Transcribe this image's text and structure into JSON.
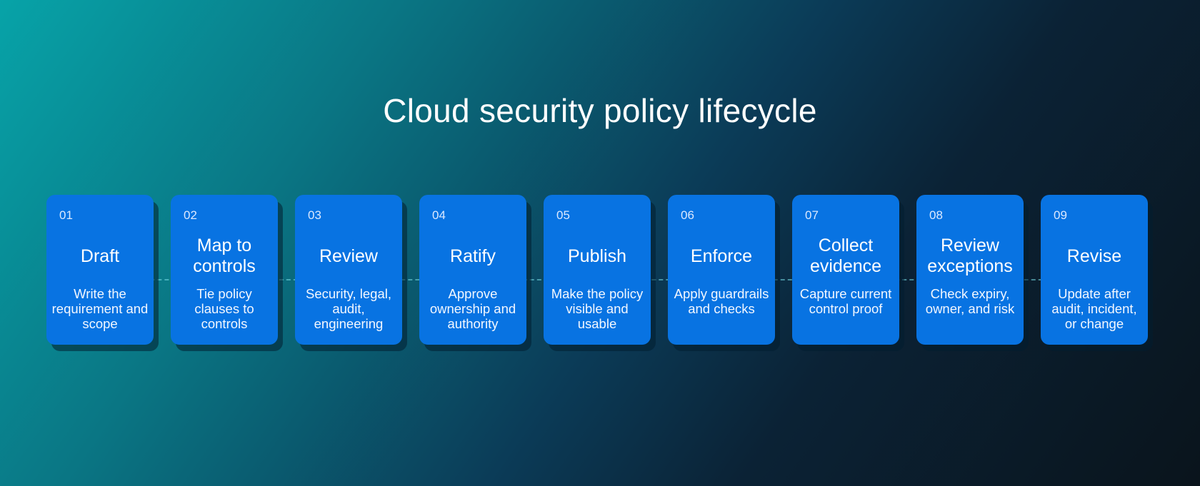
{
  "title": "Cloud security policy lifecycle",
  "colors": {
    "card": "#0873e2",
    "background_start": "#07a3a8",
    "background_end": "#0a141c"
  },
  "steps": [
    {
      "number": "01",
      "title": "Draft",
      "description": "Write the requirement and scope"
    },
    {
      "number": "02",
      "title": "Map to controls",
      "description": "Tie policy clauses to controls"
    },
    {
      "number": "03",
      "title": "Review",
      "description": "Security, legal, audit, engineering"
    },
    {
      "number": "04",
      "title": "Ratify",
      "description": "Approve ownership and authority"
    },
    {
      "number": "05",
      "title": "Publish",
      "description": "Make the policy visible and usable"
    },
    {
      "number": "06",
      "title": "Enforce",
      "description": "Apply guardrails and checks"
    },
    {
      "number": "07",
      "title": "Collect evidence",
      "description": "Capture current control proof"
    },
    {
      "number": "08",
      "title": "Review exceptions",
      "description": "Check expiry, owner, and risk"
    },
    {
      "number": "09",
      "title": "Revise",
      "description": "Update after audit, incident, or change"
    }
  ]
}
